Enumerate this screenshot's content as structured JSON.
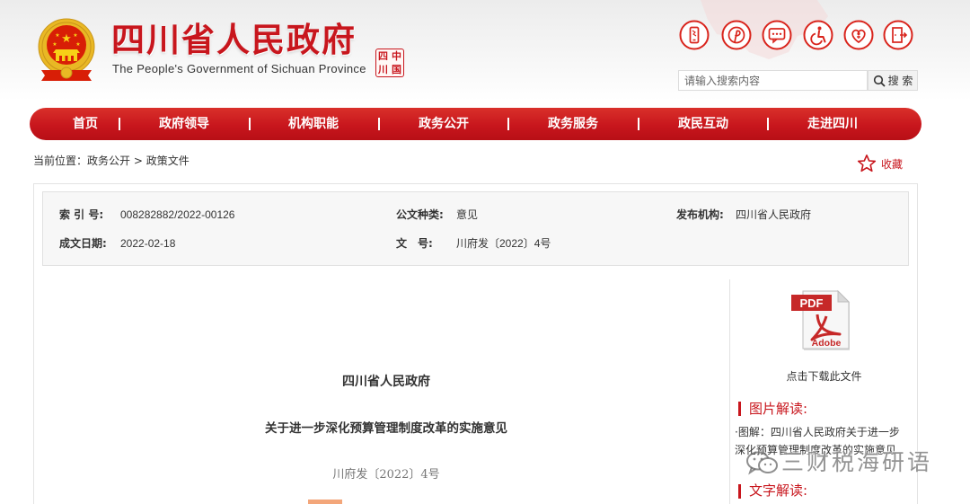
{
  "header": {
    "title": "四川省人民政府",
    "subtitle": "The People's Government of Sichuan Province",
    "emblem_icon": "national-emblem-icon",
    "seal_chars": [
      "四",
      "中",
      "川",
      "国"
    ]
  },
  "tools": [
    {
      "icon": "mobile-icon"
    },
    {
      "icon": "weibo-icon"
    },
    {
      "icon": "message-icon"
    },
    {
      "icon": "accessibility-icon"
    },
    {
      "icon": "elderly-mode-icon"
    },
    {
      "icon": "exit-icon"
    }
  ],
  "search": {
    "placeholder": "请输入搜索内容",
    "button_label": "搜 索",
    "button_icon": "search-icon"
  },
  "nav": {
    "items": [
      "首页",
      "政府领导",
      "机构职能",
      "政务公开",
      "政务服务",
      "政民互动",
      "走进四川"
    ]
  },
  "breadcrumb": {
    "prefix": "当前位置：",
    "items": [
      "政务公开",
      "政策文件"
    ],
    "separator": " > "
  },
  "favorite": {
    "label": "收藏",
    "icon": "star-icon"
  },
  "meta": {
    "index_label": "索 引 号:",
    "index_value": "008282882/2022-00126",
    "type_label": "公文种类:",
    "type_value": "意见",
    "publisher_label": "发布机构:",
    "publisher_value": "四川省人民政府",
    "date_label": "成文日期:",
    "date_value": "2022-02-18",
    "docno_label": "文　号:",
    "docno_value": "川府发〔2022〕4号"
  },
  "document": {
    "issuer": "四川省人民政府",
    "title": "关于进一步深化预算管理制度改革的实施意见",
    "doc_number": "川府发〔2022〕4号"
  },
  "sidebar": {
    "pdf_icon": "pdf-file-icon",
    "pdf_label": "PDF",
    "pdf_brand": "Adobe",
    "download_label": "点击下载此文件",
    "image_section_title": "图片解读:",
    "image_items": [
      "·图解：四川省人民政府关于进一步深化预算管理制度改革的实施意见"
    ],
    "text_section_title": "文字解读:"
  },
  "watermark": {
    "icon": "wechat-icon",
    "text": "三财税海研语"
  },
  "colors": {
    "brand_red": "#c8161d",
    "icon_red": "#d9241c",
    "text": "#333333",
    "muted": "#777777",
    "meta_bg": "#f7f7f7"
  }
}
